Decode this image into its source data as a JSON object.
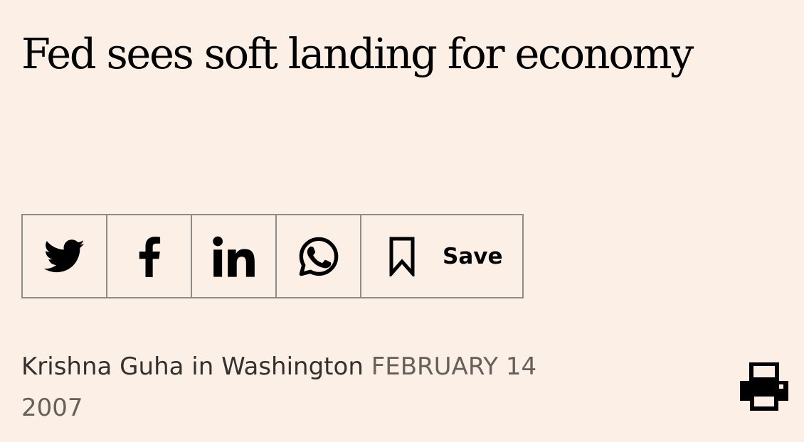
{
  "article": {
    "headline": "Fed sees soft landing for economy",
    "author": "Krishna Guha in Washington",
    "date": "FEBRUARY 14 2007"
  },
  "share_bar": {
    "buttons": [
      {
        "name": "twitter",
        "icon": "twitter-icon"
      },
      {
        "name": "facebook",
        "icon": "facebook-icon"
      },
      {
        "name": "linkedin",
        "icon": "linkedin-icon"
      },
      {
        "name": "whatsapp",
        "icon": "whatsapp-icon"
      }
    ],
    "save_label": "Save",
    "save_icon": "bookmark-icon"
  },
  "toolbar": {
    "print_icon": "printer-icon"
  },
  "colors": {
    "background": "#fcf0e6",
    "border": "#8f8b87",
    "author_text": "#33302e",
    "date_text": "#66605c"
  }
}
